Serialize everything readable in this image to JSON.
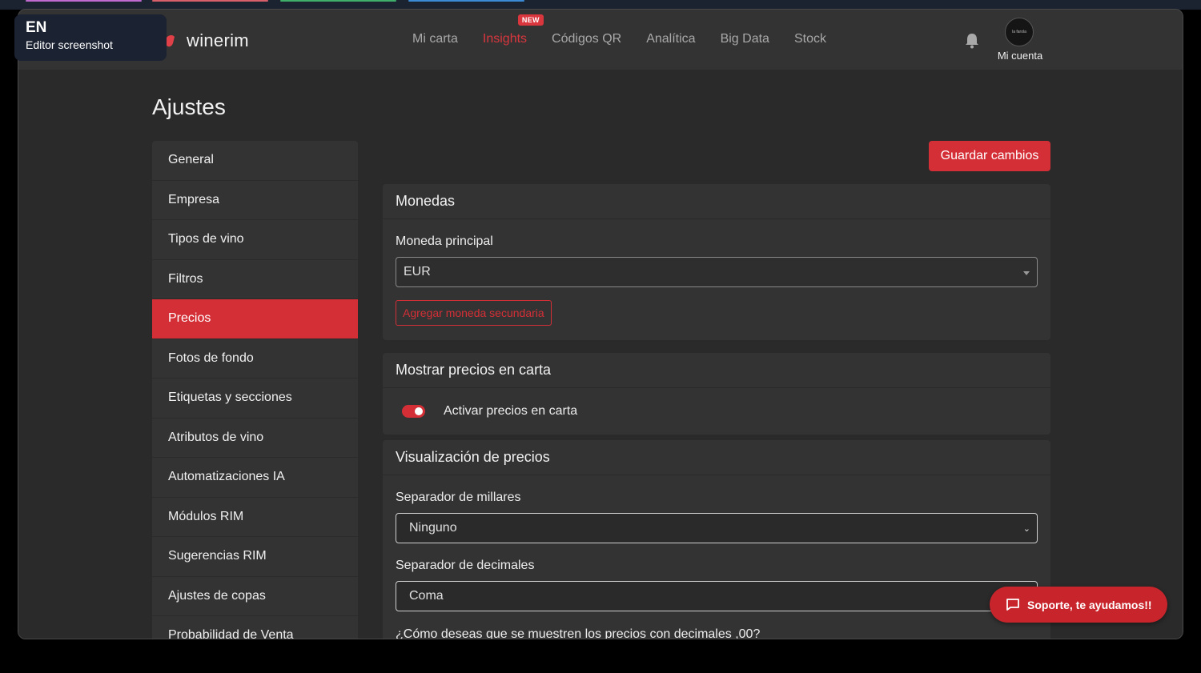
{
  "overlay": {
    "lang": "EN",
    "label": "Editor screenshot"
  },
  "nav": {
    "brand": "winerim",
    "items": [
      {
        "label": "Mi carta"
      },
      {
        "label": "Insights",
        "badge": "NEW",
        "active": true
      },
      {
        "label": "Códigos QR"
      },
      {
        "label": "Analítica"
      },
      {
        "label": "Big Data"
      },
      {
        "label": "Stock"
      }
    ],
    "account_label": "Mi cuenta",
    "avatar_text": "la farola",
    "accent_color": "#d42f36"
  },
  "page": {
    "title": "Ajustes"
  },
  "sidebar": {
    "items": [
      {
        "label": "General"
      },
      {
        "label": "Empresa"
      },
      {
        "label": "Tipos de vino"
      },
      {
        "label": "Filtros"
      },
      {
        "label": "Precios",
        "active": true
      },
      {
        "label": "Fotos de fondo"
      },
      {
        "label": "Etiquetas y secciones"
      },
      {
        "label": "Atributos de vino"
      },
      {
        "label": "Automatizaciones IA"
      },
      {
        "label": "Módulos RIM"
      },
      {
        "label": "Sugerencias RIM"
      },
      {
        "label": "Ajustes de copas"
      },
      {
        "label": "Probabilidad de Venta"
      }
    ]
  },
  "actions": {
    "save_label": "Guardar cambios"
  },
  "monedas": {
    "title": "Monedas",
    "main_label": "Moneda principal",
    "main_value": "EUR",
    "add_secondary": "Agregar moneda secundaria"
  },
  "mostrar": {
    "title": "Mostrar precios en carta",
    "toggle_label": "Activar precios en carta",
    "toggle_on": true
  },
  "visualizacion": {
    "title": "Visualización de precios",
    "thousands_label": "Separador de millares",
    "thousands_value": "Ninguno",
    "decimals_label": "Separador de decimales",
    "decimals_value": "Coma",
    "question": "¿Cómo deseas que se muestren los precios con decimales ,00?"
  },
  "support": {
    "label": "Soporte, te ayudamos!!"
  }
}
